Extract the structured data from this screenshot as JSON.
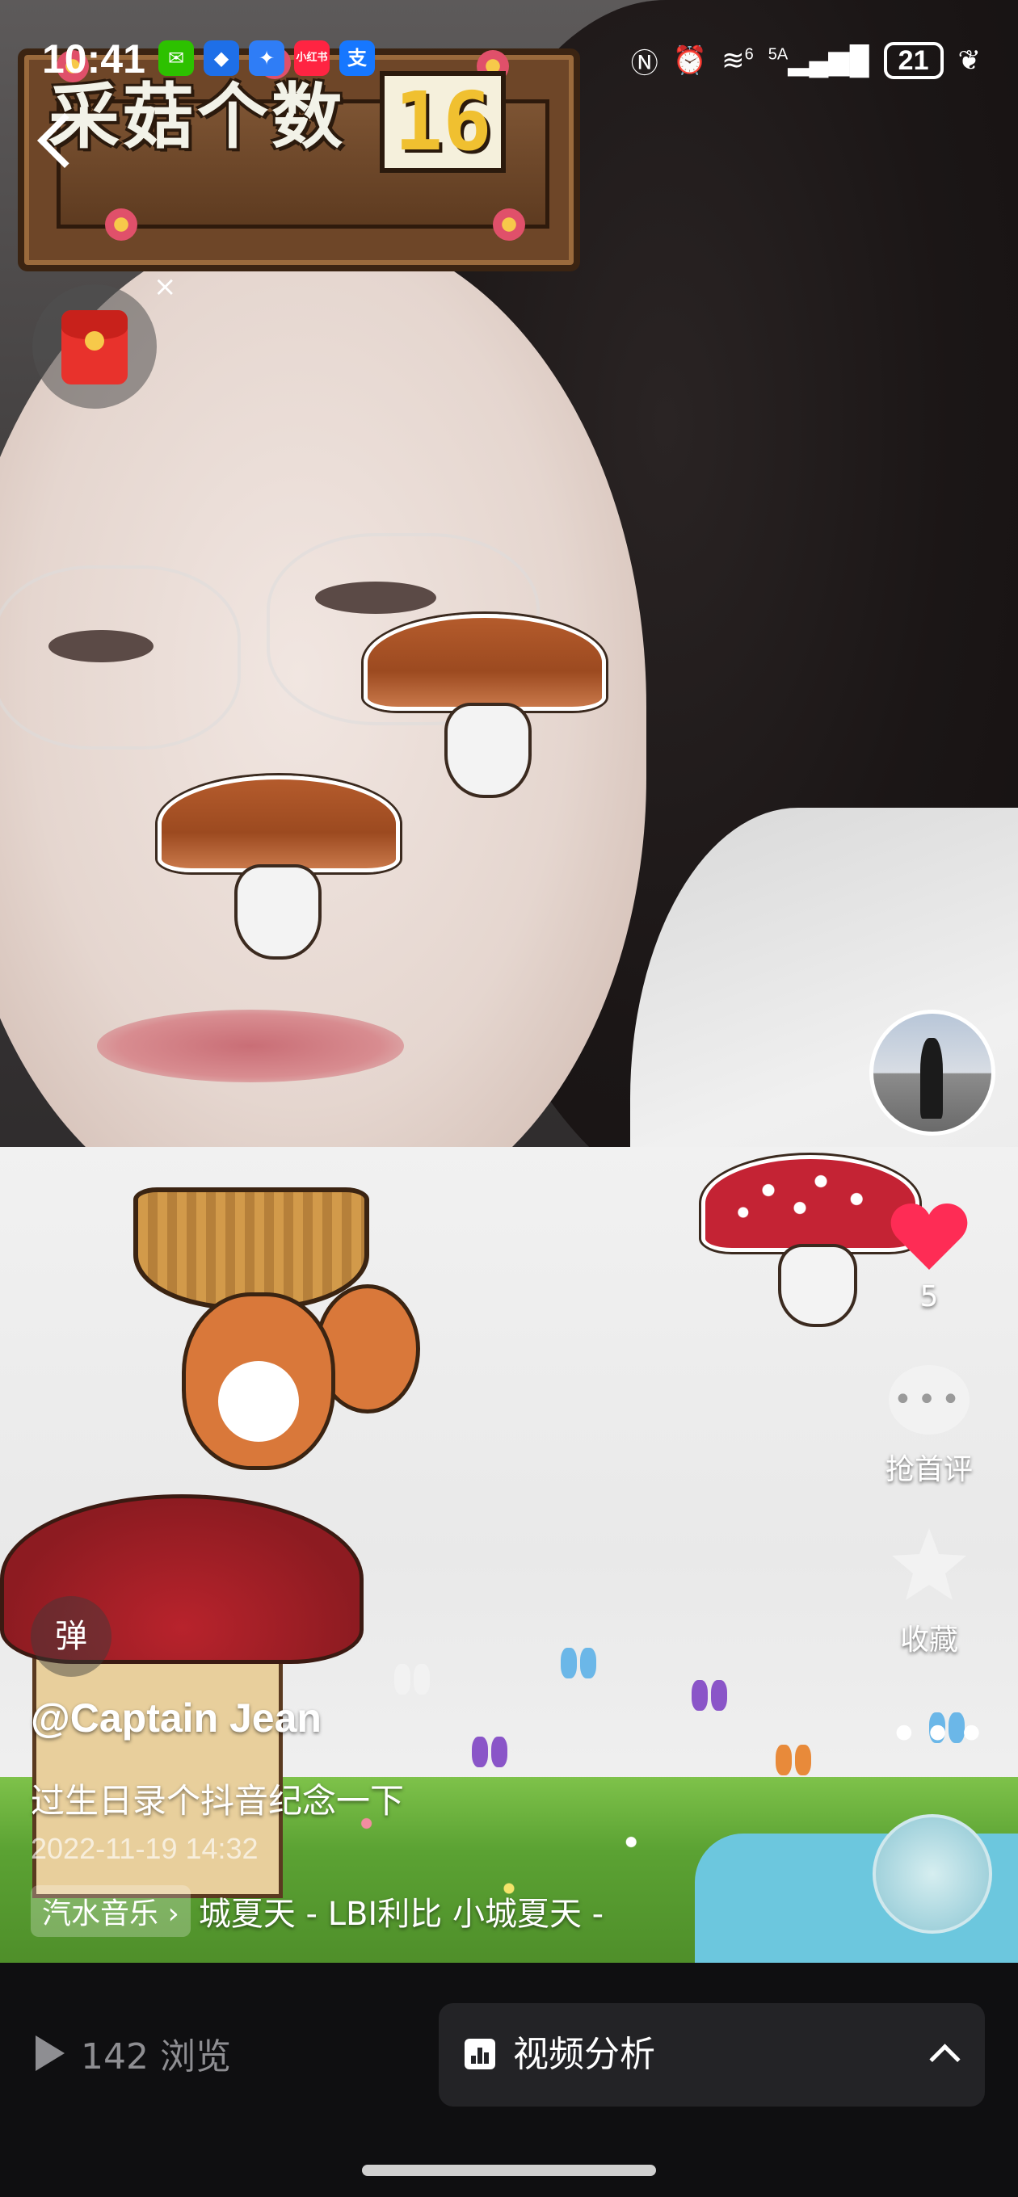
{
  "status_bar": {
    "time": "10:41",
    "apps": [
      {
        "name": "wechat-icon",
        "color": "#2dc100",
        "glyph": "✉"
      },
      {
        "name": "message-icon",
        "color": "#1e6fe8",
        "glyph": "◆"
      },
      {
        "name": "bulb-icon",
        "color": "#2f7df6",
        "glyph": "✦"
      },
      {
        "name": "xiaohongshu-icon",
        "color": "#ff2442",
        "glyph": "小红书"
      },
      {
        "name": "alipay-icon",
        "color": "#1677ff",
        "glyph": "支"
      }
    ],
    "network": "5A",
    "signal_prefix": "6",
    "battery": "21"
  },
  "effect": {
    "counter_label": "采菇个数",
    "counter_value": "16"
  },
  "red_packet": {
    "close_label": "×"
  },
  "rail": {
    "likes": "5",
    "comment_label": "抢首评",
    "favorite_label": "收藏",
    "more_label": "•••"
  },
  "post": {
    "danmu_label": "弹",
    "author": "@Captain Jean",
    "caption": "过生日录个抖音纪念一下",
    "timestamp": "2022-11-19 14:32",
    "music_chip": "汽水音乐 ›",
    "music_track": "城夏天 - LBI利比  小城夏天 -"
  },
  "bottom_bar": {
    "views": "142 浏览",
    "analysis_label": "视频分析"
  },
  "colors": {
    "like_red": "#fe2c55",
    "bar_bg": "#0f0f11",
    "button_bg": "#232326"
  }
}
